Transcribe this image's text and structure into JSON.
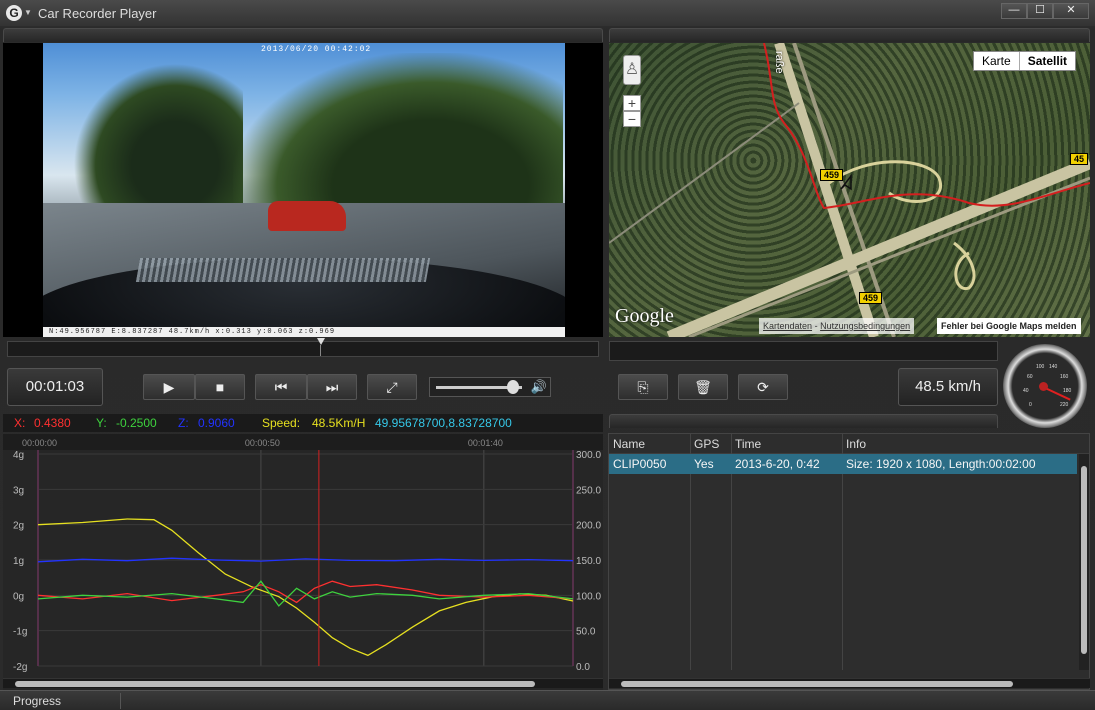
{
  "window": {
    "title": "Car Recorder Player",
    "logo": "G",
    "min": "—",
    "max": "☐",
    "close": "✕"
  },
  "video": {
    "timestamp": "2013/06/20  00:42:02",
    "overlay": "N:49.956787  E:8.837287  48.7km/h  x:0.313  y:0.063  z:0.969"
  },
  "map": {
    "type_options": [
      "Karte",
      "Satellit"
    ],
    "selected_type": "Satellit",
    "street_label": "raße",
    "route_shields": [
      "459",
      "45",
      "459"
    ],
    "logo": "Google",
    "map_data_link": "Kartendaten",
    "separator": "-",
    "terms_link": "Nutzungsbedingungen",
    "report_error": "Fehler bei Google Maps melden",
    "zoom_in": "+",
    "zoom_out": "−"
  },
  "controls": {
    "time": "00:01:03",
    "speed": "48.5 km/h",
    "play": "▶",
    "stop": "■",
    "prev": "⏮",
    "next": "⏭",
    "fullscreen": "⤢",
    "volume_icon": "🔊",
    "volume_level": 0.9,
    "export": "⎘",
    "delete": "🗑",
    "refresh": "⟳",
    "seek_position": 0.53
  },
  "sensor": {
    "x_label": "X:",
    "x_value": "0.4380",
    "y_label": "Y:",
    "y_value": "-0.2500",
    "z_label": "Z:",
    "z_value": "0.9060",
    "speed_label": "Speed:",
    "speed_value": "48.5Km/H",
    "coords": "49.95678700,8.83728700",
    "colors": {
      "x": "#ff3030",
      "y": "#3ed23e",
      "z": "#2233ff",
      "speed": "#e6e020",
      "coords": "#36c8e8"
    }
  },
  "chart_data": {
    "type": "line",
    "time_ticks": [
      "00:00:00",
      "00:00:50",
      "00:01:40"
    ],
    "left_axis": {
      "ticks": [
        "4g",
        "3g",
        "2g",
        "1g",
        "0g",
        "-1g",
        "-2g"
      ],
      "range": [
        -2,
        4
      ]
    },
    "right_axis": {
      "ticks": [
        "300.0",
        "250.0",
        "200.0",
        "150.0",
        "100.0",
        "50.0",
        "0.0"
      ],
      "range": [
        0,
        300
      ]
    },
    "cursor_time_s": 63,
    "duration_s": 120,
    "series": [
      {
        "color": "#e6e020",
        "axis": "right",
        "x": [
          0,
          10,
          20,
          26,
          30,
          36,
          42,
          48,
          54,
          58,
          62,
          66,
          70,
          74,
          78,
          84,
          90,
          96,
          102,
          108,
          114,
          120
        ],
        "values": [
          200,
          203,
          208,
          207,
          192,
          160,
          130,
          112,
          98,
          82,
          62,
          40,
          25,
          15,
          30,
          55,
          78,
          90,
          98,
          102,
          100,
          92
        ]
      },
      {
        "color": "#2233ff",
        "axis": "left",
        "x": [
          0,
          10,
          20,
          30,
          40,
          50,
          60,
          70,
          80,
          90,
          100,
          110,
          120
        ],
        "values": [
          0.95,
          1.02,
          0.98,
          1.05,
          1.0,
          0.97,
          1.03,
          0.99,
          0.98,
          1.02,
          0.99,
          1.01,
          0.98
        ]
      },
      {
        "color": "#ff3030",
        "axis": "left",
        "x": [
          0,
          10,
          20,
          30,
          40,
          46,
          50,
          54,
          58,
          62,
          66,
          70,
          76,
          84,
          90,
          100,
          110,
          120
        ],
        "values": [
          0.0,
          -0.1,
          0.05,
          -0.15,
          0.0,
          0.1,
          0.3,
          0.1,
          -0.2,
          0.2,
          0.4,
          0.25,
          0.3,
          0.15,
          0.0,
          -0.05,
          0.0,
          -0.1
        ]
      },
      {
        "color": "#3ed23e",
        "axis": "left",
        "x": [
          0,
          10,
          20,
          30,
          40,
          46,
          50,
          54,
          58,
          62,
          66,
          70,
          76,
          84,
          90,
          100,
          110,
          120
        ],
        "values": [
          -0.1,
          0.0,
          -0.05,
          0.05,
          -0.1,
          -0.2,
          0.4,
          -0.3,
          0.2,
          -0.1,
          0.1,
          -0.05,
          0.05,
          0.0,
          -0.1,
          0.0,
          0.05,
          -0.1
        ]
      }
    ]
  },
  "clips": {
    "columns": [
      "Name",
      "GPS",
      "Time",
      "Info"
    ],
    "rows": [
      {
        "name": "CLIP0050",
        "gps": "Yes",
        "time": "2013-6-20, 0:42",
        "info": "Size: 1920 x 1080, Length:00:02:00"
      }
    ]
  },
  "status": {
    "text": "Progress"
  }
}
